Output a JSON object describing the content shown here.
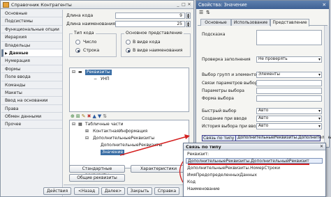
{
  "window": {
    "title": "Справочник Контрагенты"
  },
  "nav": {
    "items": [
      "Основные",
      "Подсистемы",
      "Функциональные опции",
      "Иерархия",
      "Владельцы",
      "Данные",
      "Нумерация",
      "Формы",
      "Поле ввода",
      "Команды",
      "Макеты",
      "Ввод на основании",
      "Права",
      "Обмен данными",
      "Прочее"
    ],
    "active_index": 5
  },
  "main": {
    "code_length_label": "Длина кода",
    "code_length_value": "9",
    "name_length_label": "Длина наименования",
    "name_length_value": "25",
    "code_type_group": "Тип кода",
    "code_type_opt1": "Число",
    "code_type_opt2": "Строка",
    "main_repr_group": "Основное представление",
    "main_repr_opt1": "В виде кода",
    "main_repr_opt2": "В виде наименования",
    "tree1": {
      "root": "Реквизиты",
      "child": "УНП"
    },
    "tree2": {
      "root": "Табличные части",
      "items": [
        "КонтактнаяИнформация",
        "ДополнительныеРеквизиты",
        "ДополнительныеРеквизиты",
        "Значение"
      ]
    },
    "std_attrs_button": "Стандартные реквизиты",
    "characteristics_button": "Характеристики",
    "common_attrs_button": "Общие реквизиты",
    "actions_button": "Действия",
    "back_button": "<Назад",
    "next_button": "Далее>",
    "close_button": "Закрыть",
    "help_button": "Справка"
  },
  "props": {
    "title": "Свойства: Значение",
    "tabs": [
      "Основные",
      "Использование",
      "Представление"
    ],
    "tooltip_label": "Подсказка",
    "rows": [
      {
        "label": "Проверка заполнения",
        "value": "Не проверять"
      },
      {
        "label": "Выбор групп и элементов",
        "value": "Элементы"
      },
      {
        "label": "Связи параметров выбора",
        "value": ""
      },
      {
        "label": "Параметры выбора",
        "value": ""
      },
      {
        "label": "Форма выбора",
        "value": ""
      },
      {
        "label": "Быстрый выбор",
        "value": "Авто"
      },
      {
        "label": "Создание при вводе",
        "value": "Авто"
      },
      {
        "label": "История выбора при вводе",
        "value": "Авто"
      }
    ],
    "link_by_type_label": "Связь по типу",
    "link_by_type_value": "ДополнительныеРеквизиты.Дополнительный"
  },
  "popup": {
    "title": "Связь по типу",
    "attr_label": "Реквизит:",
    "items": [
      "ДополнительныеРеквизиты.ДополнительныйРеквизит",
      "ДополнительныеРеквизиты.НомерСтроки",
      "ИмяПредопределенныхДанных",
      "Код",
      "Наименование"
    ]
  }
}
